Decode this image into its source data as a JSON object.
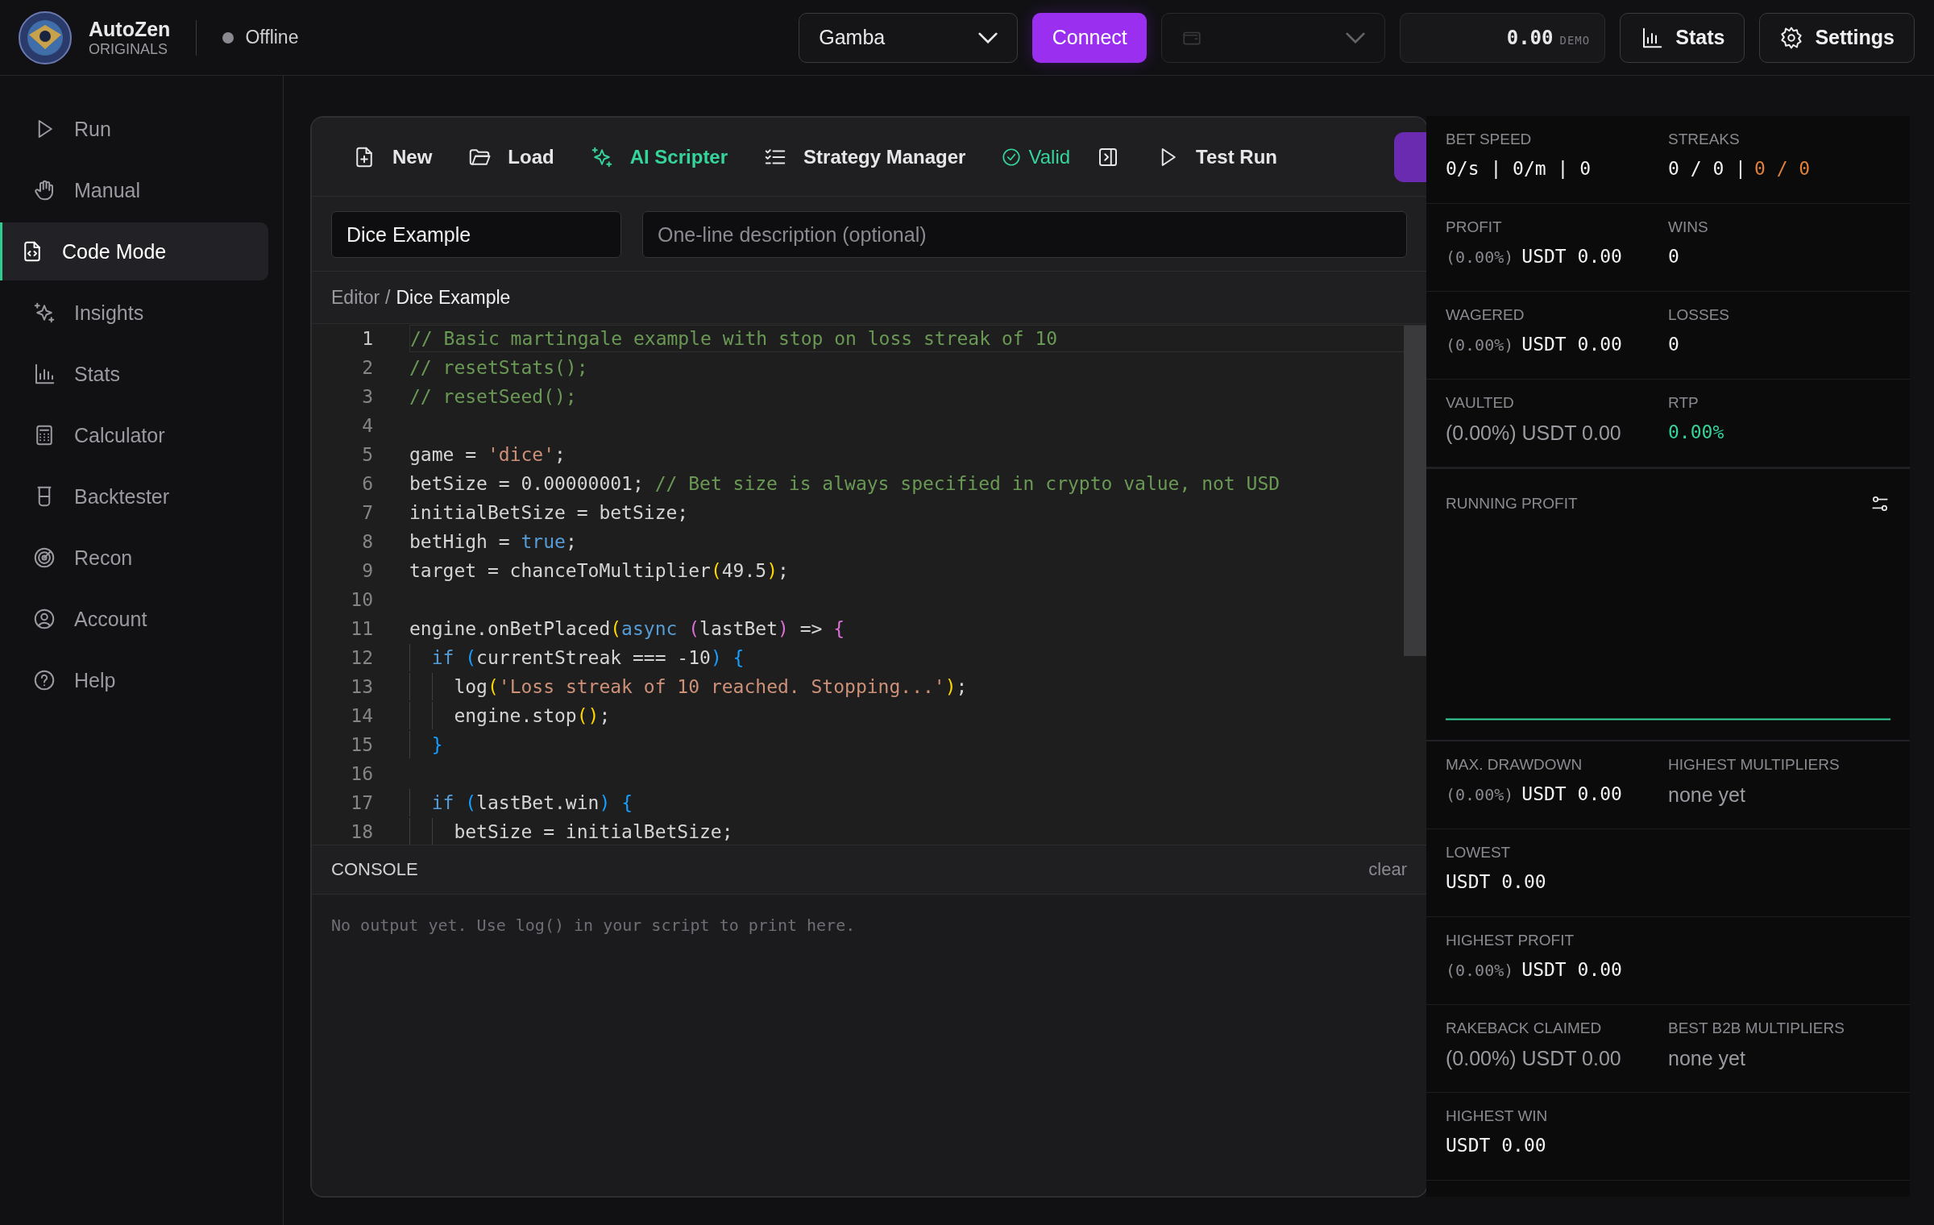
{
  "header": {
    "brand": "AutoZen",
    "brand_sub": "ORIGINALS",
    "status": {
      "label": "Offline",
      "online": false
    },
    "site_select": {
      "value": "Gamba"
    },
    "connect_button": "Connect",
    "wallet_select": {
      "disabled": true
    },
    "balance": {
      "amount": "0.00",
      "mode": "DEMO"
    },
    "buttons": [
      "Stats",
      "Settings"
    ]
  },
  "sidebar": {
    "items": [
      {
        "label": "Run",
        "selected": false
      },
      {
        "label": "Manual",
        "selected": false
      },
      {
        "label": "Code Mode",
        "selected": true
      },
      {
        "label": "Insights",
        "selected": false
      },
      {
        "label": "Stats",
        "selected": false
      },
      {
        "label": "Calculator",
        "selected": false
      },
      {
        "label": "Backtester",
        "selected": false
      },
      {
        "label": "Recon",
        "selected": false
      },
      {
        "label": "Account",
        "selected": false
      },
      {
        "label": "Help",
        "selected": false
      }
    ]
  },
  "toolbar": {
    "items": [
      {
        "label": "New",
        "kind": "plain"
      },
      {
        "label": "Load",
        "kind": "plain"
      },
      {
        "label": "AI Scripter",
        "kind": "accent"
      },
      {
        "label": "Strategy Manager",
        "kind": "plain"
      },
      {
        "label": "Valid",
        "kind": "status"
      },
      {
        "kind": "icon"
      },
      {
        "label": "Test Run",
        "kind": "plain"
      }
    ]
  },
  "script_fields": {
    "name": "Dice Example",
    "description_placeholder": "One-line description (optional)"
  },
  "breadcrumb": {
    "root": "Editor",
    "separator": "/",
    "current": "Dice Example"
  },
  "code": {
    "lines": [
      {
        "number": "1",
        "selected": true,
        "tokens": [
          {
            "text": "// Basic martingale example with stop on loss streak of 10",
            "kind": "comment"
          }
        ]
      },
      {
        "number": "2",
        "selected": false,
        "tokens": [
          {
            "text": "// resetStats();",
            "kind": "comment"
          }
        ]
      },
      {
        "number": "3",
        "selected": false,
        "tokens": [
          {
            "text": "// resetSeed();",
            "kind": "comment"
          }
        ]
      },
      {
        "number": "4",
        "selected": false
      },
      {
        "number": "5",
        "selected": false,
        "tokens": [
          {
            "text": "game = ",
            "kind": "plain"
          },
          {
            "text": "'dice'",
            "kind": "string"
          },
          {
            "text": ";",
            "kind": "plain"
          }
        ]
      },
      {
        "number": "6",
        "selected": false,
        "tokens": [
          {
            "text": "betSize = 0.00000001; ",
            "kind": "plain"
          },
          {
            "text": "// Bet size is always specified in crypto value, not USD",
            "kind": "comment"
          }
        ]
      },
      {
        "number": "7",
        "selected": false,
        "tokens": [
          {
            "text": "initialBetSize = betSize;",
            "kind": "plain"
          }
        ]
      },
      {
        "number": "8",
        "selected": false,
        "tokens": [
          {
            "text": "betHigh = ",
            "kind": "plain"
          },
          {
            "text": "true",
            "kind": "keyword"
          },
          {
            "text": ";",
            "kind": "plain"
          }
        ]
      },
      {
        "number": "9",
        "selected": false,
        "tokens": [
          {
            "text": "target = chanceToMultiplier",
            "kind": "plain"
          },
          {
            "text": "(",
            "kind": "bracket1"
          },
          {
            "text": "49.5",
            "kind": "plain"
          },
          {
            "text": ")",
            "kind": "bracket1"
          },
          {
            "text": ";",
            "kind": "plain"
          }
        ]
      },
      {
        "number": "10",
        "selected": false
      },
      {
        "number": "11",
        "selected": false,
        "tokens": [
          {
            "text": "engine.onBetPlaced",
            "kind": "plain"
          },
          {
            "text": "(",
            "kind": "bracket1"
          },
          {
            "text": "async",
            "kind": "keyword"
          },
          {
            "text": " (",
            "kind": "bracket2"
          },
          {
            "text": "lastBet",
            "kind": "plain"
          },
          {
            "text": ")",
            "kind": "bracket2"
          },
          {
            "text": " => ",
            "kind": "plain"
          },
          {
            "text": "{",
            "kind": "bracket2"
          }
        ]
      },
      {
        "number": "12",
        "selected": false,
        "tokens": [
          {
            "text": "  if",
            "kind": "keyword"
          },
          {
            "text": " (",
            "kind": "bracket3"
          },
          {
            "text": "currentStreak === -10",
            "kind": "plain"
          },
          {
            "text": ")",
            "kind": "bracket3"
          },
          {
            "text": " {",
            "kind": "bracket3"
          }
        ]
      },
      {
        "number": "13",
        "selected": false,
        "tokens": [
          {
            "text": "    log",
            "kind": "plain"
          },
          {
            "text": "(",
            "kind": "bracket1"
          },
          {
            "text": "'Loss streak of 10 reached. Stopping...'",
            "kind": "string"
          },
          {
            "text": ")",
            "kind": "bracket1"
          },
          {
            "text": ";",
            "kind": "plain"
          }
        ]
      },
      {
        "number": "14",
        "selected": false,
        "tokens": [
          {
            "text": "    engine.stop",
            "kind": "plain"
          },
          {
            "text": "()",
            "kind": "bracket1"
          },
          {
            "text": ";",
            "kind": "plain"
          }
        ]
      },
      {
        "number": "15",
        "selected": false,
        "tokens": [
          {
            "text": "  }",
            "kind": "bracket3"
          }
        ]
      },
      {
        "number": "16",
        "selected": false
      },
      {
        "number": "17",
        "selected": false,
        "tokens": [
          {
            "text": "  if",
            "kind": "keyword"
          },
          {
            "text": " (",
            "kind": "bracket3"
          },
          {
            "text": "lastBet.win",
            "kind": "plain"
          },
          {
            "text": ")",
            "kind": "bracket3"
          },
          {
            "text": " {",
            "kind": "bracket3"
          }
        ]
      },
      {
        "number": "18",
        "selected": false,
        "tokens": [
          {
            "text": "    betSize = initialBetSize;",
            "kind": "plain"
          }
        ]
      }
    ]
  },
  "console": {
    "title": "CONSOLE",
    "clear_button": "clear",
    "placeholder": "No output yet. Use log() in your script to print here."
  },
  "stats_panel": {
    "rows": [
      {
        "kind": "stats",
        "cells": [
          {
            "label": "BET SPEED",
            "parts": [
              {
                "text": "0/s | 0/m | 0",
                "kind": "mono"
              }
            ]
          },
          {
            "label": "STREAKS",
            "parts": [
              {
                "text": "0 / 0 |",
                "kind": "mono"
              },
              {
                "text": "0 / 0",
                "kind": "loss"
              }
            ]
          }
        ]
      },
      {
        "kind": "stats",
        "cells": [
          {
            "label": "PROFIT",
            "parts": [
              {
                "text": "(0.00%)",
                "kind": "dim"
              },
              {
                "text": "USDT 0.00",
                "kind": "mono"
              }
            ]
          },
          {
            "label": "WINS",
            "parts": [
              {
                "text": "0",
                "kind": "mono"
              }
            ]
          }
        ]
      },
      {
        "kind": "stats",
        "cells": [
          {
            "label": "WAGERED",
            "parts": [
              {
                "text": "(0.00%)",
                "kind": "dim"
              },
              {
                "text": "USDT 0.00",
                "kind": "mono"
              }
            ]
          },
          {
            "label": "LOSSES",
            "parts": [
              {
                "text": "0",
                "kind": "mono"
              }
            ]
          }
        ]
      },
      {
        "kind": "stats",
        "cells": [
          {
            "label": "VAULTED",
            "parts": [
              {
                "text": "(0.00%) USDT 0.00",
                "kind": "muted"
              }
            ]
          },
          {
            "label": "RTP",
            "parts": [
              {
                "text": "0.00%",
                "kind": "gain"
              }
            ]
          }
        ]
      },
      {
        "kind": "chart",
        "title": "RUNNING PROFIT"
      },
      {
        "kind": "stats",
        "cells": [
          {
            "label": "MAX. DRAWDOWN",
            "parts": [
              {
                "text": "(0.00%)",
                "kind": "dim"
              },
              {
                "text": "USDT 0.00",
                "kind": "mono"
              }
            ]
          },
          {
            "label": "HIGHEST MULTIPLIERS",
            "parts": [
              {
                "text": "none yet",
                "kind": "muted"
              }
            ]
          }
        ]
      },
      {
        "kind": "stats",
        "cells": [
          {
            "label": "LOWEST",
            "parts": [
              {
                "text": "USDT 0.00",
                "kind": "mono"
              }
            ]
          }
        ]
      },
      {
        "kind": "stats",
        "cells": [
          {
            "label": "HIGHEST PROFIT",
            "parts": [
              {
                "text": "(0.00%)",
                "kind": "dim"
              },
              {
                "text": "USDT 0.00",
                "kind": "mono"
              }
            ]
          }
        ]
      },
      {
        "kind": "stats",
        "cells": [
          {
            "label": "RAKEBACK CLAIMED",
            "parts": [
              {
                "text": "(0.00%) USDT 0.00",
                "kind": "muted"
              }
            ]
          },
          {
            "label": "BEST B2B MULTIPLIERS",
            "parts": [
              {
                "text": "none yet",
                "kind": "muted"
              }
            ]
          }
        ]
      },
      {
        "kind": "stats",
        "cells": [
          {
            "label": "HIGHEST WIN",
            "parts": [
              {
                "text": "USDT 0.00",
                "kind": "mono"
              }
            ]
          }
        ]
      }
    ]
  }
}
